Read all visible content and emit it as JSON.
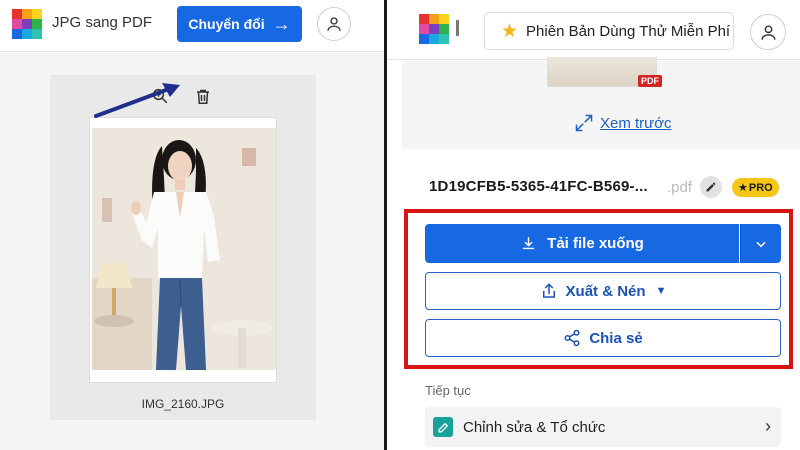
{
  "colors": {
    "primary": "#1668e3",
    "highlight": "#d81313",
    "pro_badge": "#f5c518",
    "link": "#1b5fc7",
    "logo": [
      "#e8322f",
      "#f7a11a",
      "#fbd21c",
      "#2eb34a",
      "#1aa8e0",
      "#7c3fbf",
      "#e04aa0",
      "#1668e3",
      "#30c2b0"
    ]
  },
  "left": {
    "app_title": "JPG sang PDF",
    "convert_label": "Chuyển đổi",
    "convert_icon": "arrow-right-icon",
    "avatar_icon": "user-icon",
    "tools": {
      "zoom_icon": "zoom-in-icon",
      "delete_icon": "trash-icon"
    },
    "file_name": "IMG_2160.JPG",
    "annotation_icon": "callout-arrow"
  },
  "right": {
    "trial_label": "Phiên Bản Dùng Thử Miễn Phí",
    "trial_icon": "star-icon",
    "pdf_tag": "PDF",
    "preview_link": "Xem trước",
    "doc_title": "1D19CFB5-5365-41FC-B569-...",
    "doc_ext": ".pdf",
    "pro_badge": "PRO",
    "download_label": "Tải file xuống",
    "export_label": "Xuất & Nén",
    "share_label": "Chia sẻ",
    "continue_label": "Tiếp tục",
    "edit_row_label": "Chỉnh sửa & Tổ chức"
  }
}
